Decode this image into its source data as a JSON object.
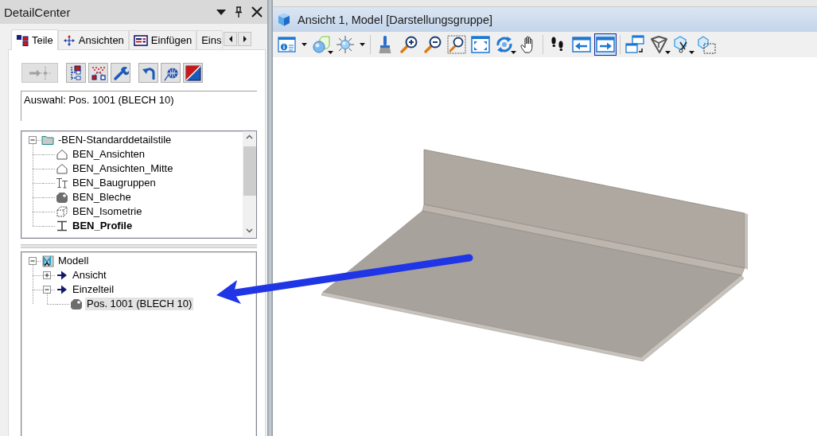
{
  "detail_center": {
    "title": "DetailCenter",
    "tabs": [
      {
        "label": "Teile",
        "selected": true
      },
      {
        "label": "Ansichten",
        "selected": false
      },
      {
        "label": "Einfügen",
        "selected": false
      },
      {
        "label": "Eins",
        "selected": false
      }
    ],
    "toolbar": [
      [
        {
          "disabled": true
        }
      ],
      [
        {
          "disabled": false
        },
        {
          "disabled": false
        },
        {
          "disabled": false
        }
      ],
      [
        {
          "disabled": false
        },
        {
          "disabled": false
        },
        {
          "disabled": false
        }
      ]
    ],
    "selection": {
      "value": "Auswahl: Pos. 1001 (BLECH 10)"
    },
    "style_tree": [
      {
        "label": "-BEN-Standarddetailstile",
        "kind": "folder",
        "expanded": true,
        "current": false,
        "children": [
          {
            "label": "BEN_Ansichten",
            "kind": "view",
            "current": false
          },
          {
            "label": "BEN_Ansichten_Mitte",
            "kind": "view",
            "current": false
          },
          {
            "label": "BEN_Baugruppen",
            "kind": "assembly",
            "current": false
          },
          {
            "label": "BEN_Bleche",
            "kind": "sheet",
            "current": false
          },
          {
            "label": "BEN_Isometrie",
            "kind": "isometric",
            "current": false
          },
          {
            "label": "BEN_Profile",
            "kind": "profile",
            "current": true
          }
        ]
      }
    ],
    "model_tree": [
      {
        "label": "Modell",
        "kind": "model",
        "expanded": true,
        "selected": false,
        "children": [
          {
            "label": "Ansicht",
            "kind": "group",
            "expanded": false,
            "selected": false
          },
          {
            "label": "Einzelteil",
            "kind": "group",
            "expanded": true,
            "selected": false,
            "children": [
              {
                "label": "Pos. 1001 (BLECH 10)",
                "kind": "sheet",
                "selected": true
              }
            ]
          }
        ]
      }
    ]
  },
  "viewport": {
    "title": "Ansicht 1, Model [Darstellungsgruppe]",
    "toolbar": [
      [
        {
          "kind": "split",
          "pressed": false
        },
        {
          "kind": "menu",
          "pressed": false
        },
        {
          "kind": "split",
          "pressed": false
        }
      ],
      [
        {
          "kind": "plain",
          "pressed": false
        },
        {
          "kind": "plain",
          "pressed": false
        },
        {
          "kind": "plain",
          "pressed": false
        },
        {
          "kind": "plain",
          "pressed": false
        },
        {
          "kind": "plain",
          "pressed": false
        },
        {
          "kind": "menu",
          "pressed": false
        },
        {
          "kind": "plain",
          "pressed": false
        }
      ],
      [
        {
          "kind": "plain",
          "pressed": false
        },
        {
          "kind": "plain",
          "pressed": false
        },
        {
          "kind": "plain",
          "pressed": true
        }
      ],
      [
        {
          "kind": "plain",
          "pressed": false
        },
        {
          "kind": "menu",
          "pressed": false
        },
        {
          "kind": "menu",
          "pressed": false
        },
        {
          "kind": "plain",
          "pressed": false
        }
      ]
    ]
  }
}
